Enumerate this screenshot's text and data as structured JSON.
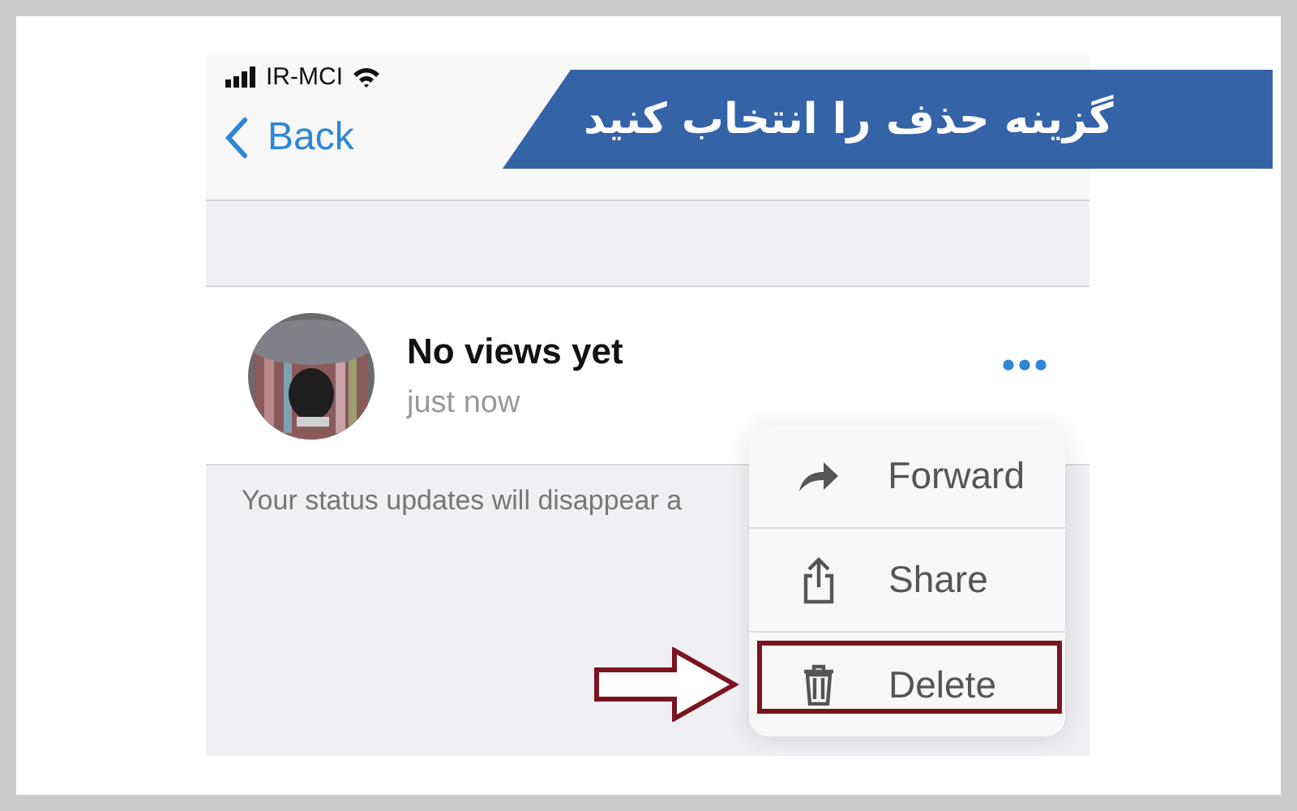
{
  "banner": {
    "text": "گزینه حذف را انتخاب کنید"
  },
  "status_bar": {
    "carrier": "IR-MCI"
  },
  "nav": {
    "back": "Back"
  },
  "status": {
    "title": "No views yet",
    "time": "just now"
  },
  "footer": "Your status updates will disappear a",
  "menu": [
    {
      "label": "Forward",
      "highlighted": false
    },
    {
      "label": "Share",
      "highlighted": false
    },
    {
      "label": "Delete",
      "highlighted": true
    }
  ]
}
